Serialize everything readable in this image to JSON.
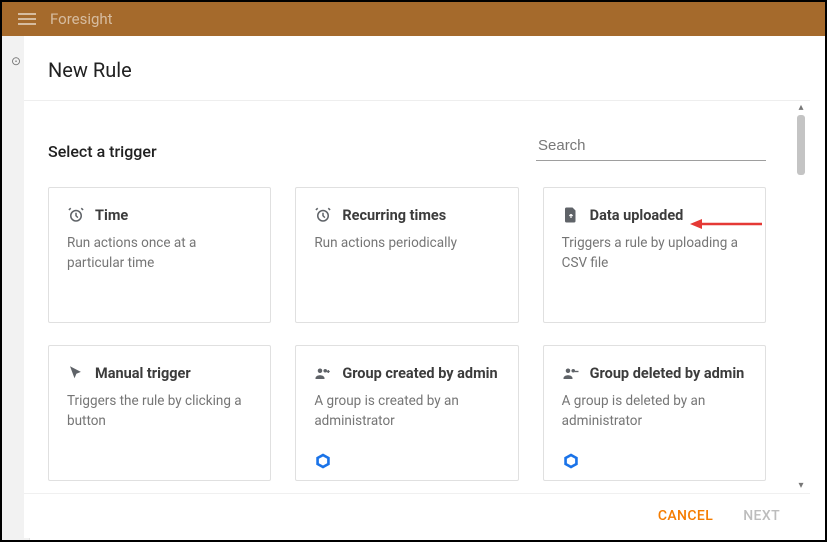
{
  "app": {
    "name": "Foresight"
  },
  "modal": {
    "title": "New Rule",
    "section_heading": "Select a trigger",
    "search_placeholder": "Search",
    "cancel_label": "CANCEL",
    "next_label": "NEXT"
  },
  "triggers": [
    {
      "title": "Time",
      "desc": "Run actions once at a particular time"
    },
    {
      "title": "Recurring times",
      "desc": "Run actions periodically"
    },
    {
      "title": "Data uploaded",
      "desc": "Triggers a rule by uploading a CSV file"
    },
    {
      "title": "Manual trigger",
      "desc": "Triggers the rule by clicking a button"
    },
    {
      "title": "Group created by admin",
      "desc": "A group is created by an administrator"
    },
    {
      "title": "Group deleted by admin",
      "desc": "A group is deleted by an administrator"
    }
  ]
}
